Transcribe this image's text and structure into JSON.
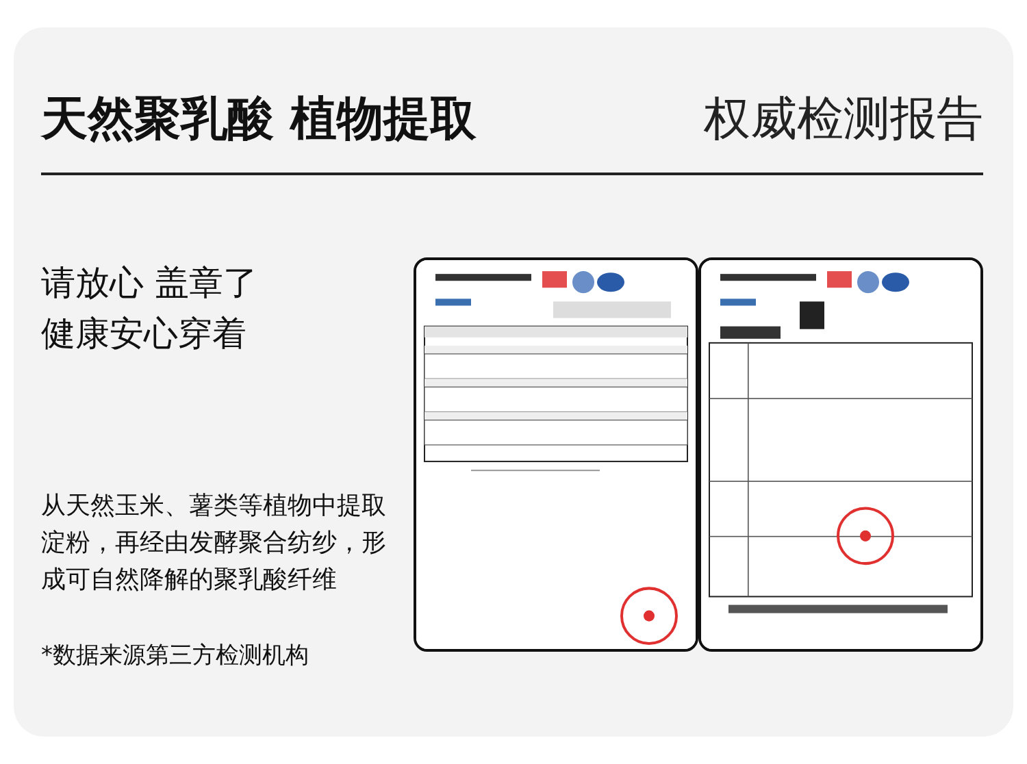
{
  "header": {
    "title": "天然聚乳酸 植物提取",
    "subtitle": "权威检测报告"
  },
  "headline": [
    "请放心 盖章了",
    "健康安心穿着"
  ],
  "description": "从天然玉米、薯类等植物中提取淀粉，再经由发酵聚合纺纱，形成可自然降解的聚乳酸纤维",
  "footnote": "*数据来源第三方检测机构"
}
